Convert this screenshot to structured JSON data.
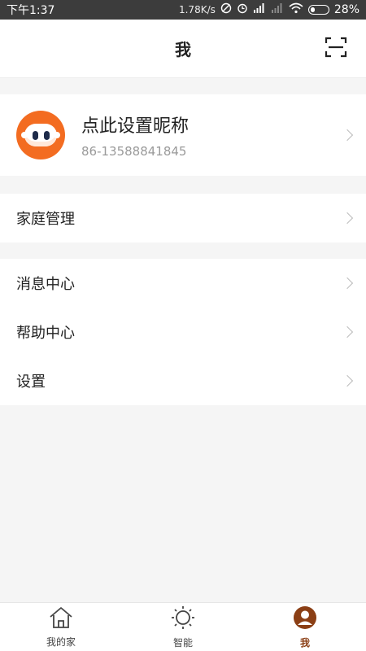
{
  "status_bar": {
    "time": "下午1:37",
    "speed": "1.78K/s",
    "battery": "28%",
    "battery_level": 0.28,
    "icons": [
      "no-disturb-icon",
      "alarm-icon",
      "hd-signal-icon",
      "signal-icon",
      "wifi-icon",
      "battery-icon"
    ]
  },
  "header": {
    "title": "我",
    "scan_icon": "scan-icon"
  },
  "profile": {
    "nickname": "点此设置昵称",
    "phone": "86-13588841845",
    "avatar_color": "#f36c21"
  },
  "menu": {
    "group1": [
      {
        "label": "家庭管理"
      }
    ],
    "group2": [
      {
        "label": "消息中心"
      },
      {
        "label": "帮助中心"
      },
      {
        "label": "设置"
      }
    ]
  },
  "bottom_nav": {
    "items": [
      {
        "label": "我的家",
        "icon": "home-icon"
      },
      {
        "label": "智能",
        "icon": "sun-icon"
      },
      {
        "label": "我",
        "icon": "user-icon",
        "active": true
      }
    ],
    "active_color": "#8b3f15"
  }
}
